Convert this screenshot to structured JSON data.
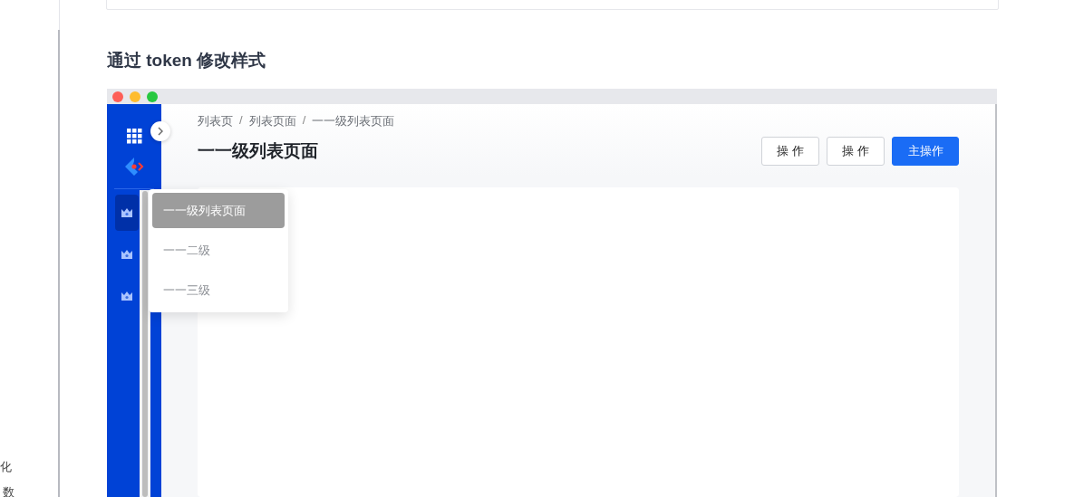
{
  "side_nav": {
    "items": [
      "化",
      "数"
    ]
  },
  "section": {
    "heading": "通过 token 修改样式"
  },
  "demo": {
    "breadcrumb": [
      {
        "kind": "link",
        "text": "列表页"
      },
      {
        "kind": "separator",
        "text": "/"
      },
      {
        "kind": "link",
        "text": "列表页面"
      },
      {
        "kind": "separator",
        "text": "/"
      },
      {
        "kind": "link",
        "text": "一一级列表页面"
      }
    ],
    "page_title": "一一级列表页面",
    "buttons": [
      {
        "label": "操 作",
        "kind": "default"
      },
      {
        "label": "操 作",
        "kind": "default"
      },
      {
        "label": "主操作",
        "kind": "primary"
      }
    ],
    "menu": [
      {
        "selected": true
      },
      {
        "selected": false
      },
      {
        "selected": false
      }
    ],
    "popup": [
      {
        "label": "一一级列表页面",
        "selected": true
      },
      {
        "label": "一一二级",
        "selected": false
      },
      {
        "label": "一一三级",
        "selected": false
      }
    ]
  }
}
